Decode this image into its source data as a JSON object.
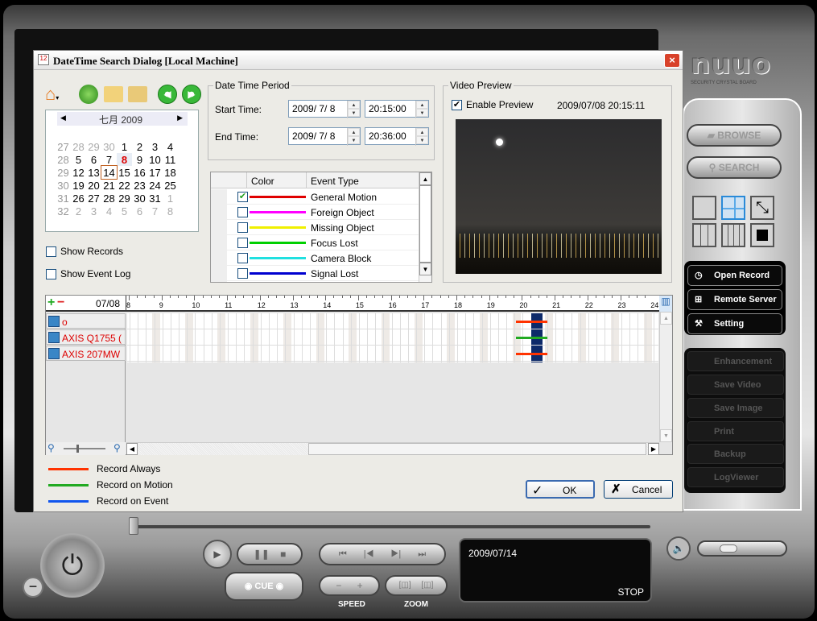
{
  "dialog": {
    "title": "DateTime Search Dialog  [Local Machine]",
    "close_label": "×"
  },
  "calendar": {
    "month_label": "七月 2009",
    "weeks": [
      {
        "wk": "27",
        "days": [
          "28",
          "29",
          "30",
          "1",
          "2",
          "3",
          "4"
        ],
        "other": [
          0,
          1,
          2
        ]
      },
      {
        "wk": "28",
        "days": [
          "5",
          "6",
          "7",
          "8",
          "9",
          "10",
          "11"
        ],
        "other": []
      },
      {
        "wk": "29",
        "days": [
          "12",
          "13",
          "14",
          "15",
          "16",
          "17",
          "18"
        ],
        "other": []
      },
      {
        "wk": "30",
        "days": [
          "19",
          "20",
          "21",
          "22",
          "23",
          "24",
          "25"
        ],
        "other": []
      },
      {
        "wk": "31",
        "days": [
          "26",
          "27",
          "28",
          "29",
          "30",
          "31",
          "1"
        ],
        "other": [
          6
        ]
      },
      {
        "wk": "32",
        "days": [
          "2",
          "3",
          "4",
          "5",
          "6",
          "7",
          "8"
        ],
        "other": [
          0,
          1,
          2,
          3,
          4,
          5,
          6
        ]
      }
    ],
    "selected": "8",
    "today": "14"
  },
  "options": {
    "show_records": "Show Records",
    "show_event_log": "Show Event Log",
    "show_records_checked": false,
    "show_event_log_checked": false
  },
  "period": {
    "legend": "Date Time Period",
    "start_label": "Start Time:",
    "end_label": "End Time:",
    "start_date": "2009/  7/  8",
    "start_time": "20:15:00",
    "end_date": "2009/  7/  8",
    "end_time": "20:36:00"
  },
  "events": {
    "col_color": "Color",
    "col_type": "Event Type",
    "rows": [
      {
        "name": "General Motion",
        "color": "#e00000",
        "checked": true
      },
      {
        "name": "Foreign Object",
        "color": "#ff00ff",
        "checked": false
      },
      {
        "name": "Missing Object",
        "color": "#f0f000",
        "checked": false
      },
      {
        "name": "Focus Lost",
        "color": "#00d000",
        "checked": false
      },
      {
        "name": "Camera Block",
        "color": "#20e0e0",
        "checked": false
      },
      {
        "name": "Signal Lost",
        "color": "#0000d0",
        "checked": false
      }
    ]
  },
  "preview": {
    "legend": "Video Preview",
    "enable_label": "Enable Preview",
    "enabled": true,
    "timestamp": "2009/07/08 20:15:11"
  },
  "timeline": {
    "date": "07/08",
    "hours": [
      "8",
      "9",
      "10",
      "11",
      "12",
      "13",
      "14",
      "15",
      "16",
      "17",
      "18",
      "19",
      "20",
      "21",
      "22",
      "23",
      "24"
    ],
    "selection": {
      "start": "20:15",
      "end": "20:36"
    },
    "cameras": [
      {
        "name": "o",
        "record": "always"
      },
      {
        "name": "AXIS Q1755 (",
        "record": "motion"
      },
      {
        "name": "AXIS 207MW",
        "record": "always"
      }
    ],
    "record_span": {
      "start": "20:00",
      "end": "20:45"
    }
  },
  "legend": [
    {
      "label": "Record Always",
      "color": "#ff3300"
    },
    {
      "label": "Record on Motion",
      "color": "#22aa22"
    },
    {
      "label": "Record on Event",
      "color": "#1155ee"
    }
  ],
  "buttons": {
    "ok": "OK",
    "cancel": "Cancel"
  },
  "side": {
    "logo": "nuuo",
    "logo_sub": "SECURITY CRYSTAL BOARD",
    "browse": "BROWSE",
    "search": "SEARCH",
    "main": [
      "Open Record",
      "Remote Server",
      "Setting"
    ],
    "disabled": [
      "Enhancement",
      "Save Video",
      "Save  Image",
      "Print",
      "Backup",
      "LogViewer"
    ]
  },
  "player": {
    "display_date": "2009/07/14",
    "status": "STOP",
    "cue": "CUE",
    "speed": "SPEED",
    "zoom": "ZOOM"
  }
}
